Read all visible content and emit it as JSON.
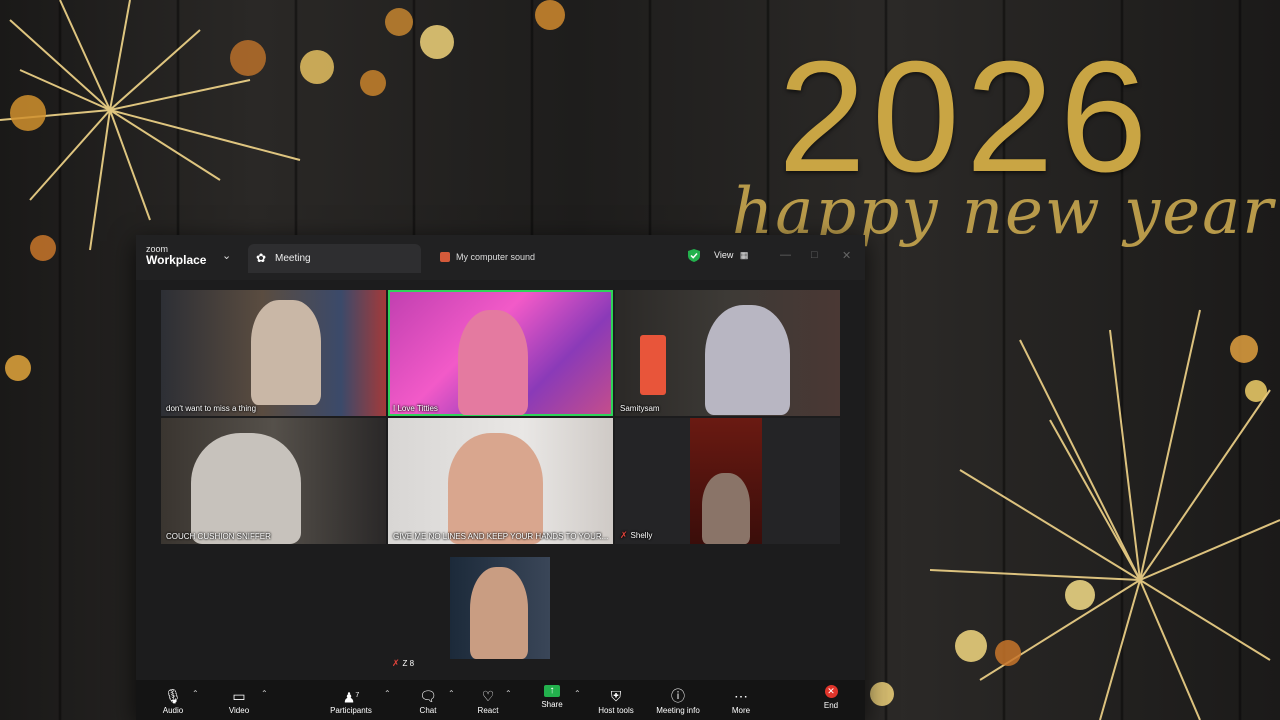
{
  "background": {
    "year": "2026",
    "greeting": "happy new year",
    "accent_color": "#c9a544"
  },
  "window": {
    "brand_small": "zoom",
    "brand_big": "Workplace",
    "tab_meeting": "Meeting",
    "tab_sound": "My computer sound",
    "view_label": "View"
  },
  "participants": [
    {
      "name": "don't want to miss a thing"
    },
    {
      "name": "I Love Titties"
    },
    {
      "name": "Samitysam"
    },
    {
      "name": "COUCH CUSHION SNIFFER"
    },
    {
      "name": "GIVE ME NO LINES AND KEEP YOUR HANDS TO YOUR..."
    },
    {
      "name": "Shelly"
    },
    {
      "name": "Z 8"
    }
  ],
  "toolbar": {
    "audio": "Audio",
    "video": "Video",
    "participants": "Participants",
    "participants_count": "7",
    "chat": "Chat",
    "react": "React",
    "share": "Share",
    "host_tools": "Host tools",
    "meeting_info": "Meeting info",
    "more": "More",
    "end": "End"
  }
}
